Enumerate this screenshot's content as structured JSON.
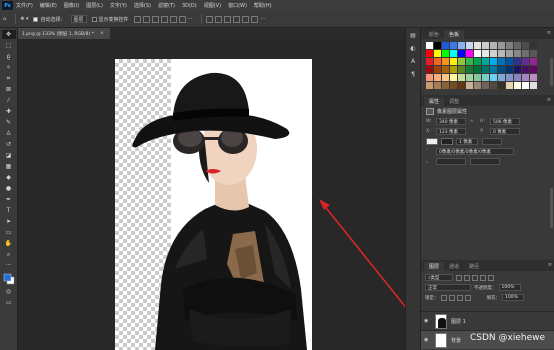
{
  "menubar": {
    "logo": "Ps",
    "items": [
      "文件(F)",
      "编辑(E)",
      "图像(I)",
      "图层(L)",
      "文字(Y)",
      "选择(S)",
      "滤镜(T)",
      "3D(D)",
      "视图(V)",
      "窗口(W)",
      "帮助(H)"
    ]
  },
  "options": {
    "auto_select_label": "自动选择：",
    "auto_select_value": "图层",
    "show_transform_label": "显示变换控件"
  },
  "document": {
    "tab_title": "1.png @ 133% (图层 1, RGB/8) *",
    "close": "×"
  },
  "panels": {
    "swatch_tabs": [
      "颜色",
      "色板"
    ],
    "props_tabs": [
      "属性",
      "调整"
    ],
    "props_title": "像素图层属性",
    "props": {
      "w_label": "W:",
      "w_value": "340 像素",
      "h_label": "H:",
      "h_value": "506 像素",
      "x_label": "X:",
      "x_value": "123 像素",
      "y_label": "Y:",
      "y_value": "0 像素",
      "align_value": "0像素/0像素/0像素/0像素",
      "small_value": "1 像素"
    },
    "layers_tabs": [
      "图层",
      "通道",
      "路径"
    ],
    "layers": {
      "kind_label": "类型",
      "blend_mode": "正常",
      "opacity_label": "不透明度：",
      "opacity_value": "100%",
      "lock_label": "锁定：",
      "fill_label": "填充：",
      "fill_value": "100%",
      "items": [
        {
          "name": "图层 1"
        },
        {
          "name": "背景"
        }
      ]
    }
  },
  "watermark": "CSDN @xiehewe",
  "colors": {
    "accent": "#31a8ff",
    "arrow": "#d9252a"
  }
}
